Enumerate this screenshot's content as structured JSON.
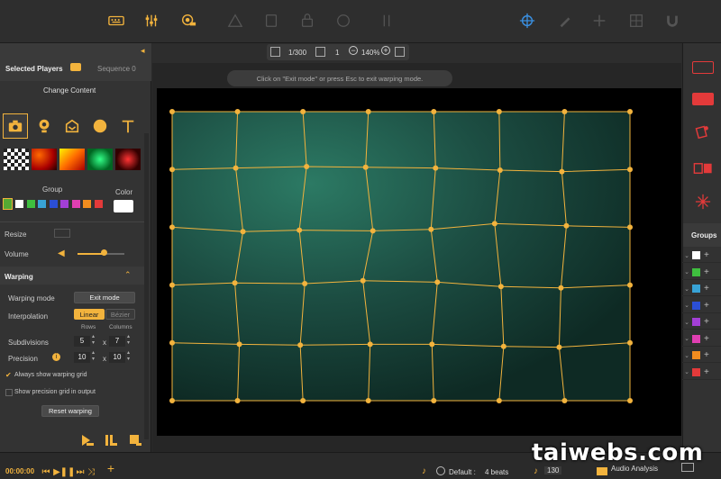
{
  "colors": {
    "accent": "#f2b33d",
    "red": "#e33a3a",
    "blue": "#3a8fe0",
    "panel": "#333333"
  },
  "toolbar": {
    "left_icons": [
      "keyboard-icon",
      "mixer-sliders-icon",
      "projector-icon"
    ],
    "mid_icons": [
      "warning-icon",
      "document-icon",
      "lock-icon",
      "circle-icon",
      "split-icon"
    ],
    "right_icons": [
      "crosshair-target-icon",
      "pen-icon",
      "plus-icon",
      "grid-icon",
      "magnet-icon"
    ]
  },
  "left_panel": {
    "selected_players": "Selected Players",
    "sequence": "Sequence 0",
    "change_content": "Change Content",
    "content_types": [
      "camera-icon",
      "webcam-icon",
      "stage-icon",
      "circle-icon",
      "text-icon"
    ],
    "group_label": "Group",
    "color_label": "Color",
    "group_colors": [
      "#ffffff",
      "#3fbf3f",
      "#38a3d6",
      "#2b4fd6",
      "#a33fd6",
      "#e03fb2",
      "#f28c1f",
      "#e33a3a"
    ],
    "resize_label": "Resize",
    "volume_label": "Volume",
    "volume_level": 0.55,
    "warping": {
      "title": "Warping",
      "mode_label": "Warping mode",
      "exit_mode_button": "Exit mode",
      "interpolation_label": "Interpolation",
      "linear": "Linear",
      "bezier": "Bézier",
      "rows_label": "Rows",
      "columns_label": "Columns",
      "subdivisions_label": "Subdivisions",
      "rows": "5",
      "columns": "7",
      "x_sign": "x",
      "precision_label": "Precision",
      "precision_a": "10",
      "precision_b": "10",
      "always_show": "Always show warping grid",
      "show_precision": "Show precision grid in output",
      "reset_button": "Reset warping"
    },
    "bottom_buttons": [
      "play-all-icon",
      "pause-all-icon",
      "stop-all-icon"
    ]
  },
  "canvas": {
    "page": "1/300",
    "layer": "1",
    "zoom": "140%",
    "banner": "Click on \"Exit mode\" or press Esc to exit warping mode."
  },
  "right_panel": {
    "tools": [
      "rectangle-outline-icon",
      "rectangle-filled-icon",
      "media-tag-icon",
      "link-rects-icon",
      "sparkle-icon"
    ],
    "groups_label": "Groups",
    "group_rows": [
      "#ffffff",
      "#3fbf3f",
      "#38a3d6",
      "#2b4fd6",
      "#a33fd6",
      "#e03fb2",
      "#f28c1f",
      "#e33a3a"
    ]
  },
  "bottom_bar": {
    "timecode": "00:00:00",
    "bpm": "130",
    "default_label": "Default :",
    "beats": "4 beats",
    "audio_analysis": "Audio Analysis"
  },
  "watermark": "taiwebs.com"
}
